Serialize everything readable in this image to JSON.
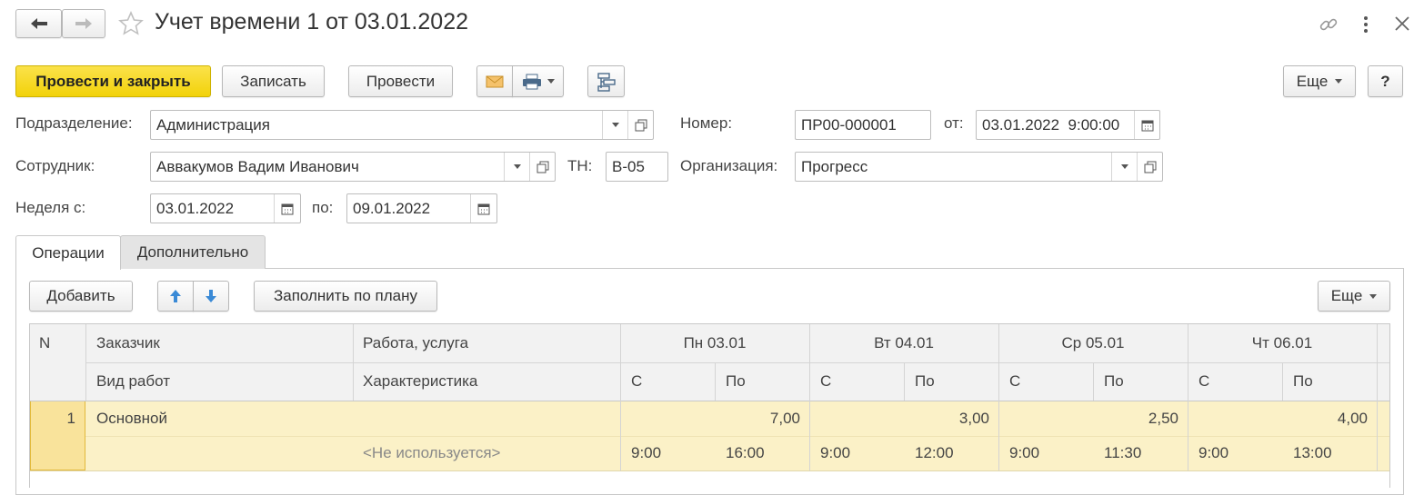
{
  "window": {
    "title": "Учет времени 1 от 03.01.2022"
  },
  "toolbar": {
    "post_close_label": "Провести и закрыть",
    "save_label": "Записать",
    "post_label": "Провести",
    "more_label": "Еще",
    "help_label": "?"
  },
  "form": {
    "department_label": "Подразделение:",
    "department_value": "Администрация",
    "number_label": "Номер:",
    "number_value": "ПР00-000001",
    "date_from_label": "от:",
    "date_value": "03.01.2022  9:00:00",
    "employee_label": "Сотрудник:",
    "employee_value": "Аввакумов Вадим Иванович",
    "tn_label": "ТН:",
    "tn_value": "В-05",
    "org_label": "Организация:",
    "org_value": "Прогресс",
    "week_label": "Неделя с:",
    "week_from": "03.01.2022",
    "week_to_label": "по:",
    "week_to": "09.01.2022"
  },
  "tabs": [
    {
      "label": "Операции",
      "active": true
    },
    {
      "label": "Дополнительно",
      "active": false
    }
  ],
  "table_toolbar": {
    "add_label": "Добавить",
    "fill_label": "Заполнить по плану",
    "more_label": "Еще"
  },
  "table": {
    "header_row1": {
      "n": "N",
      "customer": "Заказчик",
      "work": "Работа, услуга",
      "days": [
        "Пн 03.01",
        "Вт 04.01",
        "Ср 05.01",
        "Чт 06.01"
      ]
    },
    "header_row2": {
      "work_type": "Вид работ",
      "characteristic": "Характеристика",
      "from": "С",
      "to": "По"
    },
    "rows": [
      {
        "n": "1",
        "customer": "Основной",
        "characteristic": "<Не используется>",
        "totals": [
          "7,00",
          "3,00",
          "2,50",
          "4,00"
        ],
        "times": [
          {
            "from": "9:00",
            "to": "16:00"
          },
          {
            "from": "9:00",
            "to": "12:00"
          },
          {
            "from": "9:00",
            "to": "11:30"
          },
          {
            "from": "9:00",
            "to": "13:00"
          }
        ]
      }
    ]
  },
  "colors": {
    "primary_button": "#f2d20a",
    "selected_row": "#fbf1c7",
    "selected_cell": "#f9e39b",
    "header_bg": "#f2f2f2"
  }
}
